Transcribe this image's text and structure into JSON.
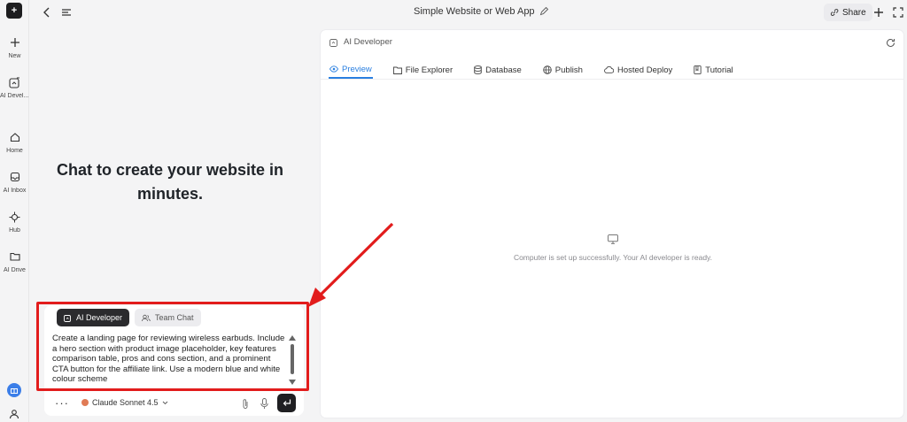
{
  "app": {
    "title": "Simple Website or Web App",
    "logo_glyph": "+"
  },
  "rail": {
    "items": [
      {
        "icon": "plus-icon",
        "label": "New"
      },
      {
        "icon": "ai-developer-icon",
        "label": "AI Devel..."
      },
      {
        "icon": "home-icon",
        "label": "Home"
      },
      {
        "icon": "inbox-icon",
        "label": "AI Inbox"
      },
      {
        "icon": "hub-icon",
        "label": "Hub"
      },
      {
        "icon": "folder-icon",
        "label": "AI Drive"
      }
    ]
  },
  "topbar": {
    "share_label": "Share"
  },
  "chat": {
    "hero_line1": "Chat to create your website in",
    "hero_line2": "minutes.",
    "tabs": [
      {
        "label": "AI Developer",
        "active": true
      },
      {
        "label": "Team Chat",
        "active": false
      }
    ],
    "prompt_text": "Create a landing page for reviewing wireless earbuds. Include a hero section with product image placeholder, key features comparison table, pros and cons section, and a prominent CTA button for the affiliate link. Use a modern blue and white colour scheme",
    "more_label": "···",
    "model_label": "Claude Sonnet 4.5"
  },
  "panel": {
    "header_title": "AI Developer",
    "tabs": [
      {
        "label": "Preview",
        "icon": "eye-icon",
        "active": true
      },
      {
        "label": "File Explorer",
        "icon": "file-explorer-icon",
        "active": false
      },
      {
        "label": "Database",
        "icon": "database-icon",
        "active": false
      },
      {
        "label": "Publish",
        "icon": "globe-icon",
        "active": false
      },
      {
        "label": "Hosted Deploy",
        "icon": "cloud-icon",
        "active": false
      },
      {
        "label": "Tutorial",
        "icon": "book-icon",
        "active": false
      }
    ],
    "status_text": "Computer is set up successfully. Your AI developer is ready."
  },
  "colors": {
    "accent": "#2a7fe0",
    "annotation_red": "#e21c1c",
    "dark_button": "#1f1f22"
  }
}
